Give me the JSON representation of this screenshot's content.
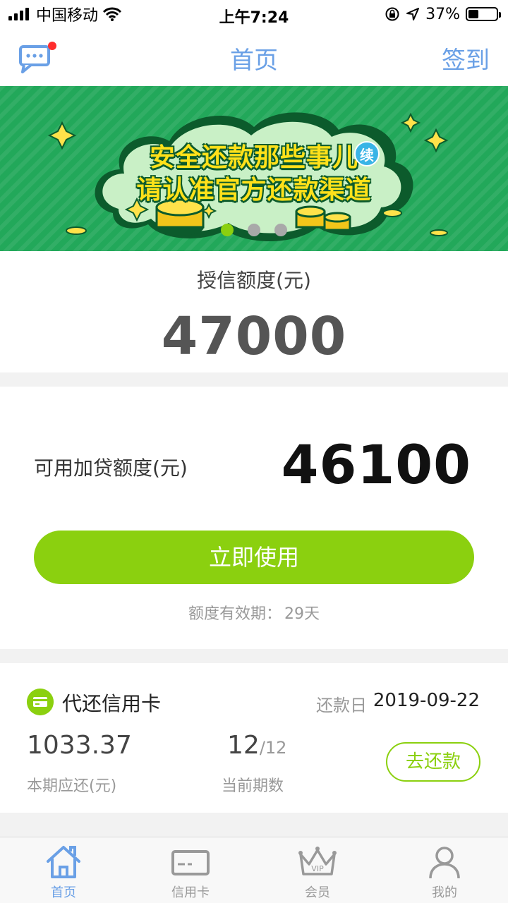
{
  "status_bar": {
    "carrier": "中国移动",
    "time": "上午7:24",
    "battery": "37%",
    "battery_level": 0.37
  },
  "nav": {
    "title": "首页",
    "sign_in": "签到",
    "has_unread": true
  },
  "banner": {
    "line1": "安全还款那些事儿",
    "badge": "续",
    "line2": "请认准官方还款渠道",
    "slide_count": 3,
    "active_slide": 0,
    "colors": {
      "background": "#22a85a",
      "active_dot": "#8bd00f",
      "inactive_dot": "#a9a9a9"
    }
  },
  "credit": {
    "label": "授信额度(元)",
    "value": "47000"
  },
  "loan": {
    "label": "可用加贷额度(元)",
    "value": "46100",
    "use_button": "立即使用",
    "validity_label": "额度有效期：",
    "validity_value": "29天"
  },
  "card_repay": {
    "title": "代还信用卡",
    "repay_day_label": "还款日",
    "repay_day": "2019-09-22",
    "amount": "1033.37",
    "amount_label": "本期应还(元)",
    "period_current": "12",
    "period_total": "/12",
    "period_label": "当前期数",
    "repay_button": "去还款"
  },
  "tabs": [
    {
      "label": "首页",
      "icon": "home-icon",
      "active": true
    },
    {
      "label": "信用卡",
      "icon": "credit-card-icon",
      "active": false
    },
    {
      "label": "会员",
      "icon": "vip-crown-icon",
      "active": false
    },
    {
      "label": "我的",
      "icon": "user-icon",
      "active": false
    }
  ],
  "colors": {
    "accent_blue": "#6aa0e6",
    "accent_green": "#8bd00f",
    "unread_dot": "#ff2d2d"
  }
}
